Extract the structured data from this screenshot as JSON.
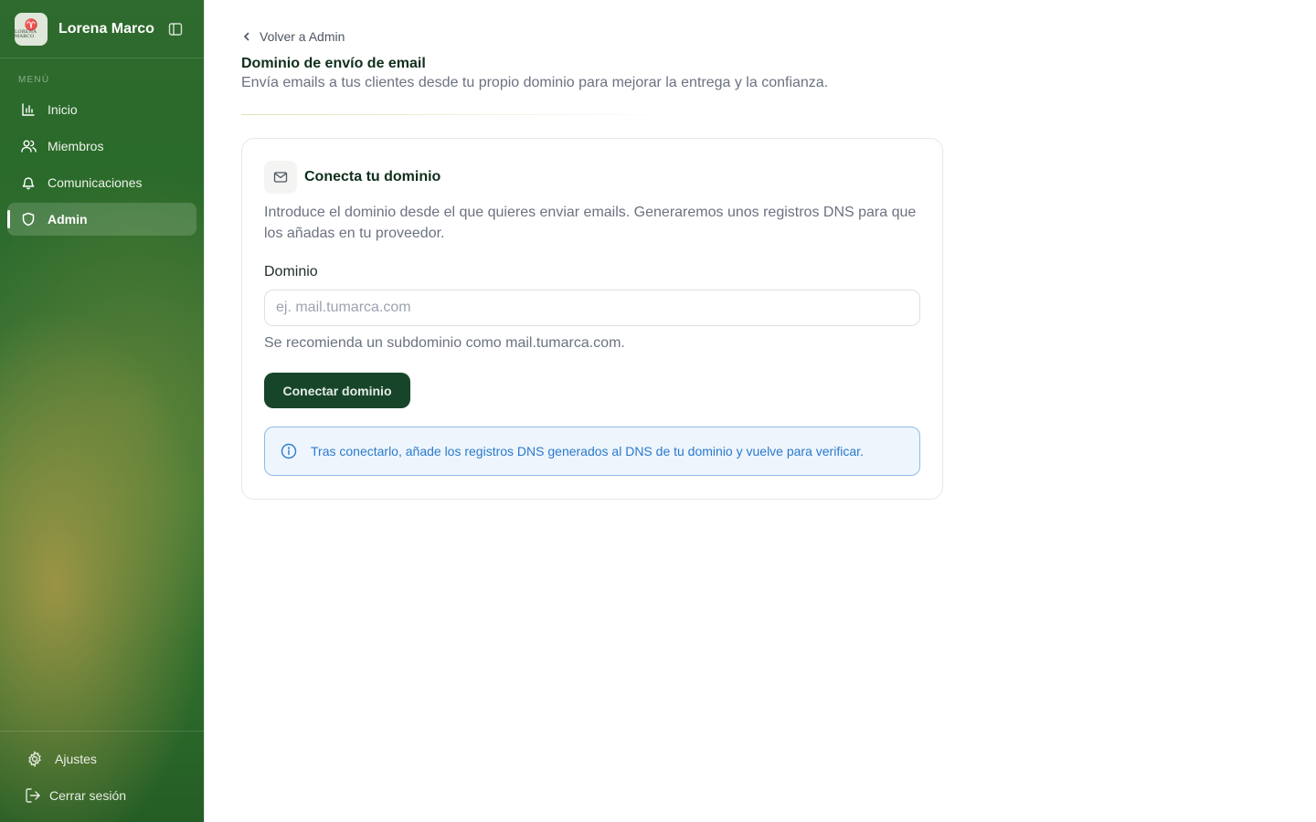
{
  "app": {
    "brand_name": "Lorena Marco",
    "logo_text": "LORENA MARCO"
  },
  "sidebar": {
    "menu_label": "MENÚ",
    "items": [
      {
        "label": "Inicio",
        "icon": "bar-chart-icon",
        "active": false
      },
      {
        "label": "Miembros",
        "icon": "users-icon",
        "active": false
      },
      {
        "label": "Comunicaciones",
        "icon": "bell-icon",
        "active": false
      },
      {
        "label": "Admin",
        "icon": "shield-icon",
        "active": true
      }
    ],
    "footer": {
      "settings_label": "Ajustes",
      "logout_label": "Cerrar sesión"
    }
  },
  "header": {
    "back_label": "Volver a Admin",
    "title": "Dominio de envío de email",
    "subtitle": "Envía emails a tus clientes desde tu propio dominio para mejorar la entrega y la confianza."
  },
  "card": {
    "title": "Conecta tu dominio",
    "description": "Introduce el dominio desde el que quieres enviar emails. Generaremos unos registros DNS para que los añadas en tu proveedor.",
    "field_label": "Dominio",
    "input_placeholder": "ej. mail.tumarca.com",
    "input_value": "",
    "hint": "Se recomienda un subdominio como mail.tumarca.com.",
    "button_label": "Conectar dominio",
    "info_text": "Tras conectarlo, añade los registros DNS generados al DNS de tu dominio y vuelve para verificar."
  },
  "colors": {
    "primary_button": "#17452a",
    "info_text": "#2a7acc",
    "info_bg": "#eef5fd",
    "info_border": "#8fbbe8"
  }
}
